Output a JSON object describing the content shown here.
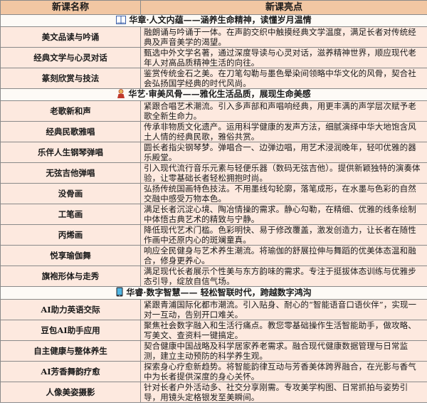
{
  "header": {
    "col1": "新课名称",
    "col2": "新课亮点"
  },
  "sections": [
    {
      "icon": "book-icon",
      "title": "华章·人文内蕴——涵养生命精神，读懂岁月温情",
      "rows": [
        {
          "name": "美文品读与吟诵",
          "desc": "融朗诵与吟诵于一体。在声韵交织中触摸经典文学温度，满足长者对传统经典及声音美学的渴望。"
        },
        {
          "name": "经典文学与心灵对话",
          "desc": "甄选中外文学名著，通过深度导读与心灵对话，滋养精神世界，顺应现代老年人对高品质精神生活的向往。"
        },
        {
          "name": "篆刻欣赏与技法",
          "desc": "鉴赏传统金石之美。在刀笔勾勒与墨色晕染间领略中华文化的风骨，契合社会弘扬国学经典的时代风尚。"
        }
      ]
    },
    {
      "icon": "performer-icon",
      "title": "华艺·审美风骨——雅化生活品质，展现生命美感",
      "rows": [
        {
          "name": "老歌新和声",
          "desc": "紧跟合唱艺术潮流。引入多声部和声唱响经典，用更丰满的声学层次赋予老歌全新生命力。"
        },
        {
          "name": "经典民歌雅唱",
          "desc": "传承非物质文化遗产。运用科学健康的发声方法，细腻演绎中华大地饱含风土人情的经典民歌，雅俗共赏。"
        },
        {
          "name": "乐伴人生钢琴弹唱",
          "desc": "圆长者指尖钢琴梦。弹唱合一、边弹边唱，用艺术浸润晚年，轻叩优雅的器乐殿堂。"
        },
        {
          "name": "无弦吉他弹唱",
          "desc": "引入现代流行音乐元素与轻便乐器（数码无弦吉他）。提供新颖独特的演奏体验，让零基础长者轻松拥抱时尚。"
        },
        {
          "name": "没骨画",
          "desc": "弘扬传统国画特色技法。不用墨线勾轮廓，落笔成形，在水墨与色彩的自然交融中感受万物本色。"
        },
        {
          "name": "工笔画",
          "desc": "满足长者沉淀心境、陶冶情操的需求。静心勾勒，在精细、优雅的线条绘制中体悟古典艺术的精致与宁静。"
        },
        {
          "name": "丙烯画",
          "desc": "降低现代艺术门槛。色彩明快、易于修改覆盖，激发创造力，让长者在随性作画中还原内心的斑斓童真。"
        },
        {
          "name": "悦享瑜伽舞",
          "desc": "响应全民健身与艺术养生潮流。将瑜伽的舒展拉伸与舞蹈的优美体态温和融合，修身更养心。"
        },
        {
          "name": "旗袍形体与走秀",
          "desc": "满足现代长者展示个性美与东方韵味的需求。专注于挺拔体态训练与优雅步态引导，绽放自信气场。"
        }
      ]
    },
    {
      "icon": "phone-icon",
      "title": "华睿·数字智慧—— 轻松智联时代，跨越数字鸿沟",
      "rows": [
        {
          "name": "AI助力英语交际",
          "desc": "紧跟青浦国际化都市潮流。引入贴身、耐心的“智能语音口语伙伴”，实现一对一互动，告别开口难关。"
        },
        {
          "name": "豆包AI助手应用",
          "desc": "聚焦社会数字融入和生活行痛点。教您零基础操作生活智能助手，做攻略、写美文、查资料一键搞定。"
        },
        {
          "name": "自主健康与整体养生",
          "desc": "契合健康中国战略及科学居家养老需求。融合现代健康数据管理与日常监测，建立主动预防的科学养生观。"
        },
        {
          "name": "AI芳香舞韵疗愈",
          "desc": "探索身心疗愈新趋势。将智能韵律互动与芳香美体跨界融合，在光影与香气中为长者提供深度的身心关怀。"
        },
        {
          "name": "人像美姿摄影",
          "desc": "针对长者户外活动多、社交分享刚需。专攻美学构图、日常抓拍与姿势引导，用镜头定格银发至美瞬间。"
        }
      ]
    }
  ]
}
